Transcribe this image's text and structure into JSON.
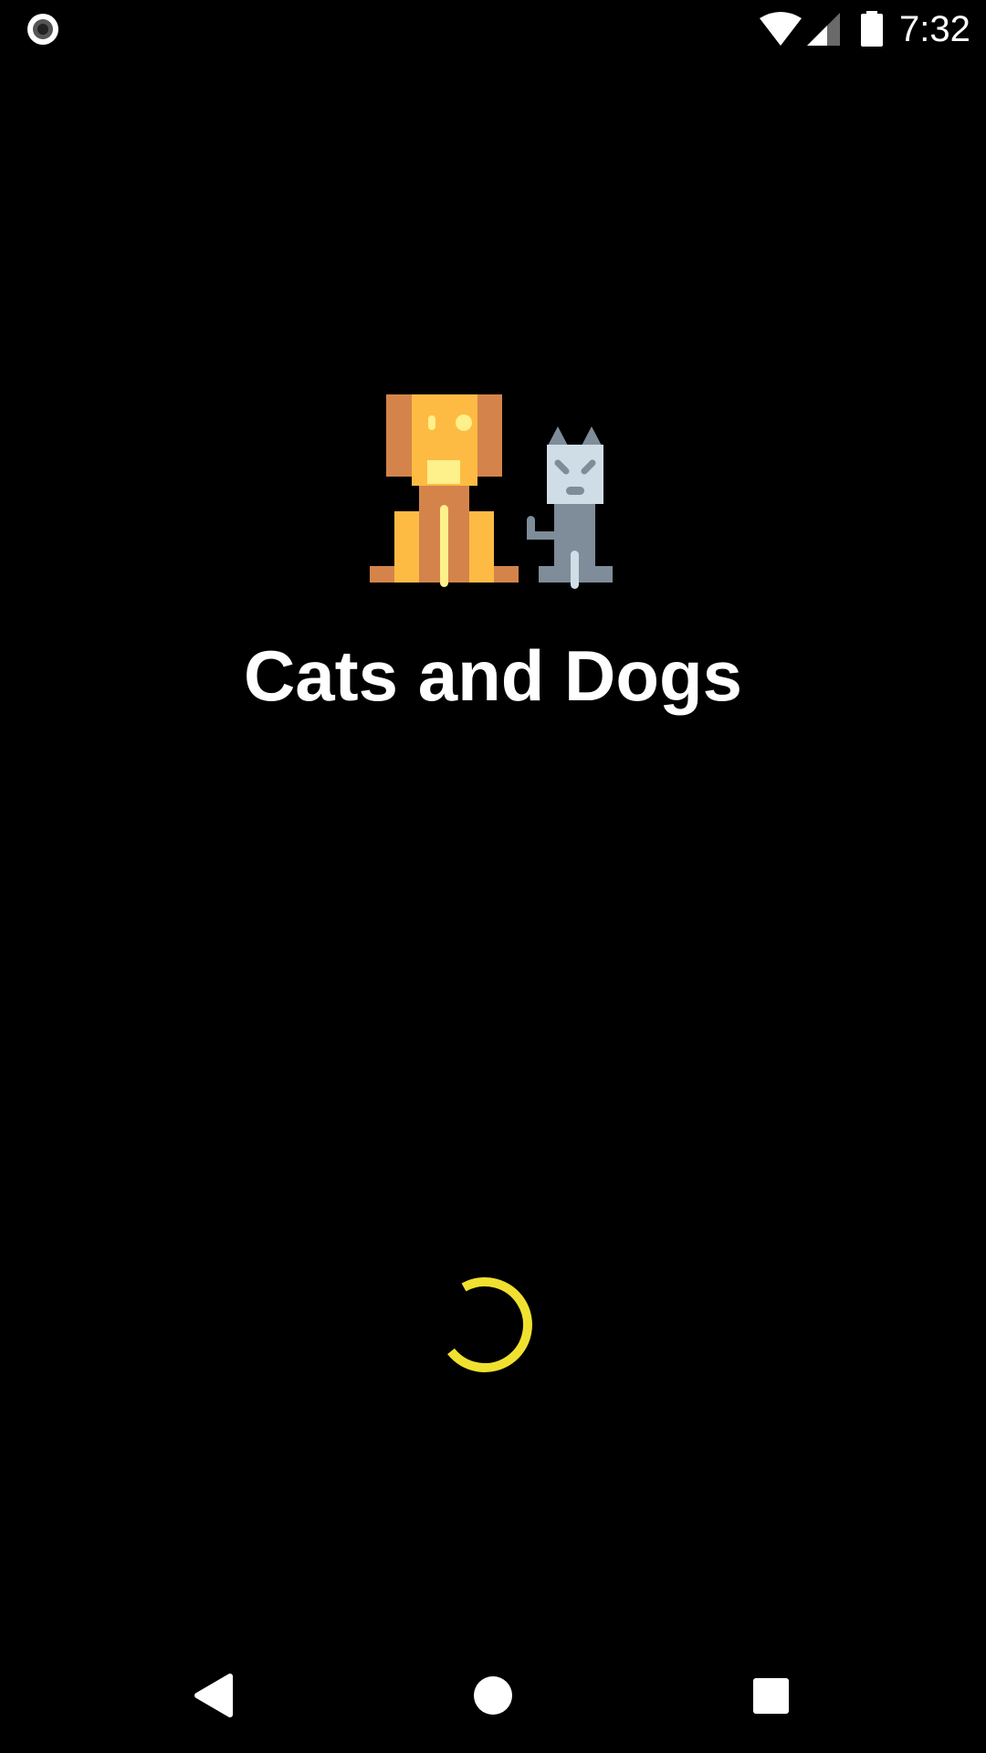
{
  "status_bar": {
    "time": "7:32",
    "icons": [
      "screen-record-icon",
      "wifi-icon",
      "cell-signal-icon",
      "battery-icon"
    ]
  },
  "splash": {
    "title": "Cats and Dogs",
    "logo": "dog-and-cat-illustration",
    "loading_indicator": "loading-spinner"
  },
  "navigation_bar": {
    "buttons": [
      "back",
      "home",
      "recents"
    ]
  },
  "colors": {
    "background": "#000000",
    "text": "#ffffff",
    "spinner": "#f0e130",
    "dog_dark": "#d4844a",
    "dog_light": "#fdbb44",
    "dog_accent": "#fef08a",
    "cat_body": "#7f8c99",
    "cat_face": "#cfdde6"
  }
}
